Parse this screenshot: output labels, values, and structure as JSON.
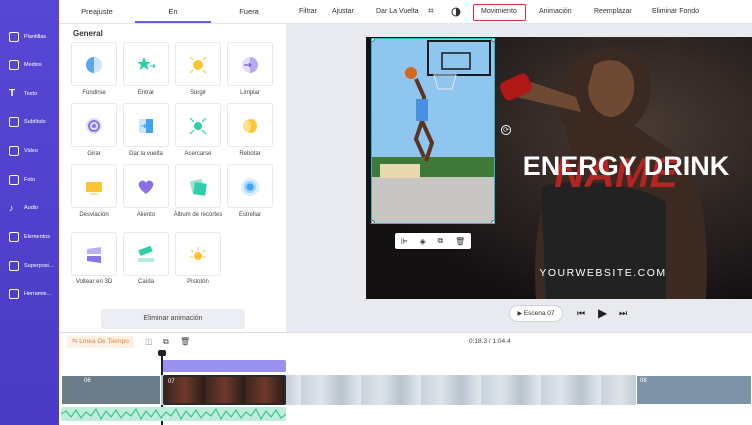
{
  "sidebar": {
    "items": [
      {
        "label": "Plantillas",
        "icon": "template-icon"
      },
      {
        "label": "Medios",
        "icon": "media-icon"
      },
      {
        "label": "Texto",
        "icon": "text-icon"
      },
      {
        "label": "Subtítulo",
        "icon": "subtitle-icon"
      },
      {
        "label": "Video",
        "icon": "video-icon"
      },
      {
        "label": "Foto",
        "icon": "photo-icon"
      },
      {
        "label": "Audio",
        "icon": "audio-icon"
      },
      {
        "label": "Elementos",
        "icon": "elements-icon"
      },
      {
        "label": "Superposi...",
        "icon": "overlay-icon"
      },
      {
        "label": "Herramie...",
        "icon": "tools-icon"
      }
    ]
  },
  "panel": {
    "tabs": [
      "Preajuste",
      "En",
      "Fuera"
    ],
    "section": "General",
    "effects": [
      "Fundirse",
      "Entrar",
      "Surgir",
      "Limpiar",
      "Girar",
      "Dar la vuelta",
      "Acercarse",
      "Rebotar",
      "Desviación",
      "Aliento",
      "Álbum de recortes",
      "Estrellar",
      "Voltear en 3D",
      "Caída",
      "Pistotón"
    ],
    "remove_label": "Eliminar animación"
  },
  "toolbar": {
    "filtrar": "Filtrar",
    "ajustar": "Ajustar",
    "dar_vuelta": "Dar La Vuelta",
    "movimiento": "Movimiento",
    "animacion": "Animación",
    "reemplazar": "Reemplazar",
    "eliminar_fondo": "Eliminar Fondo"
  },
  "stage": {
    "headline": "ENERGY DRINK",
    "watermark": "NAME",
    "website": "YOURWEBSITE.COM"
  },
  "player": {
    "scene": "Escena 07"
  },
  "timeline": {
    "label": "Línea De Tiempo",
    "time": "0:18.3 / 1:04.4",
    "clip_number": "07",
    "clip_number_next": "08",
    "clip_number_prev": "06"
  },
  "colors": {
    "accent": "#6b5ce7",
    "sidebar": "#5143cf",
    "highlight": "#e03030",
    "selection": "#2fb8c9",
    "waveform": "#7ed9b8"
  }
}
